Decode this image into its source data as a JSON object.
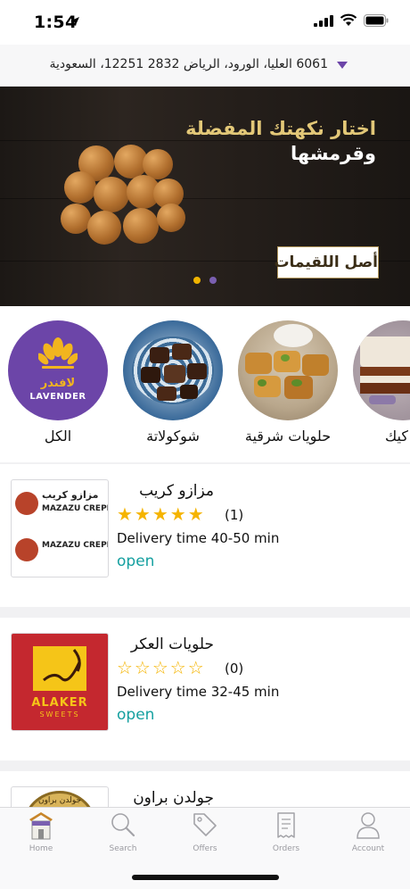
{
  "status_bar": {
    "time": "1:54"
  },
  "address": {
    "text": "6061 العليا، الورود، الرياض 2832 12251، السعودية"
  },
  "banner": {
    "headline_1": "اختار نكهتك المفضلة",
    "headline_2": "وقرمشها",
    "logo_text": "أصل اللقيمات",
    "slides_count": 2,
    "active_slide": 1
  },
  "categories": [
    {
      "label": "الكل",
      "logo_text_ar": "لافندر",
      "logo_text_en": "LAVENDER"
    },
    {
      "label": "شوكولاتة"
    },
    {
      "label": "حلويات شرقية"
    },
    {
      "label": "كيك"
    }
  ],
  "restaurants": [
    {
      "name": "مزازو كريب",
      "rating": 5,
      "reviews": "(1)",
      "delivery": "Delivery time 40-50 min",
      "status": "open",
      "logo_text_en": "MAZAZU CREPE",
      "logo_text_ar": "مزازو كريب"
    },
    {
      "name": "حلويات العكر",
      "rating": 0,
      "reviews": "(0)",
      "delivery": "Delivery time 32-45 min",
      "status": "open",
      "logo_text_en": "ALAKER",
      "logo_text_en_sub": "SWEETS"
    },
    {
      "name": "جولدن براون",
      "logo_text_ar": "جولدن براون"
    }
  ],
  "tabs": [
    {
      "label": "Home",
      "icon": "home-icon",
      "active": true
    },
    {
      "label": "Search",
      "icon": "search-icon"
    },
    {
      "label": "Offers",
      "icon": "tag-icon"
    },
    {
      "label": "Orders",
      "icon": "receipt-icon"
    },
    {
      "label": "Account",
      "icon": "user-icon"
    }
  ],
  "colors": {
    "accent_teal": "#15a0a0",
    "star_gold": "#f5b400",
    "lavender": "#6c45a8",
    "dot_active": "#f0b400",
    "dot_inactive": "#7a5fb0"
  }
}
